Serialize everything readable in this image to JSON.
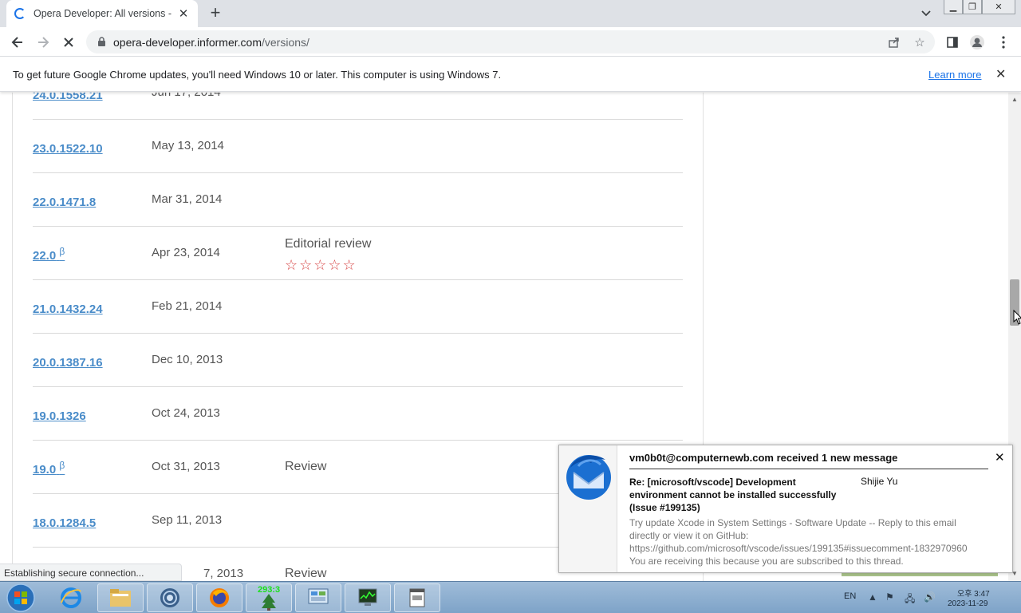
{
  "browser": {
    "tab_title": "Opera Developer: All versions -",
    "url_host": "opera-developer.informer.com",
    "url_path": "/versions/",
    "infobar_message": "To get future Google Chrome updates, you'll need Windows 10 or later. This computer is using Windows 7.",
    "infobar_link": "Learn more",
    "status_text": "Establishing secure connection..."
  },
  "versions": [
    {
      "version": "24.0.1558.21",
      "beta": "",
      "date": "Jun 17, 2014",
      "review": ""
    },
    {
      "version": "23.0.1522.10",
      "beta": "",
      "date": "May 13, 2014",
      "review": ""
    },
    {
      "version": "22.0.1471.8",
      "beta": "",
      "date": "Mar 31, 2014",
      "review": ""
    },
    {
      "version": "22.0",
      "beta": "β",
      "date": "Apr 23, 2014",
      "review": "Editorial review",
      "stars": "☆☆☆☆☆",
      "rating": 0
    },
    {
      "version": "21.0.1432.24",
      "beta": "",
      "date": "Feb 21, 2014",
      "review": ""
    },
    {
      "version": "20.0.1387.16",
      "beta": "",
      "date": "Dec 10, 2013",
      "review": ""
    },
    {
      "version": "19.0.1326",
      "beta": "",
      "date": "Oct 24, 2013",
      "review": ""
    },
    {
      "version": "19.0",
      "beta": "β",
      "date": "Oct 31, 2013",
      "review": "Review"
    },
    {
      "version": "18.0.1284.5",
      "beta": "",
      "date": "Sep 11, 2013",
      "review": ""
    },
    {
      "version": "",
      "beta": "",
      "date": "7, 2013",
      "review": "Review"
    }
  ],
  "notification": {
    "title": "vm0b0t@computernewb.com received 1 new message",
    "subject": "Re: [microsoft/vscode] Development environment cannot be installed successfully (Issue #199135)",
    "sender": "Shijie Yu",
    "body": "Try update Xcode in System Settings - Software Update -- Reply to this email directly or view it on GitHub: https://github.com/microsoft/vscode/issues/199135#issuecomment-1832970960 You are receiving this because you are subscribed to this thread."
  },
  "taskbar": {
    "badge": "293:3",
    "language": "EN",
    "clock_time": "오후 3:47",
    "clock_date": "2023-11-29"
  },
  "colors": {
    "link": "#4a8cc9",
    "star": "#d84b4b",
    "chrome_blue": "#1a73e8"
  }
}
